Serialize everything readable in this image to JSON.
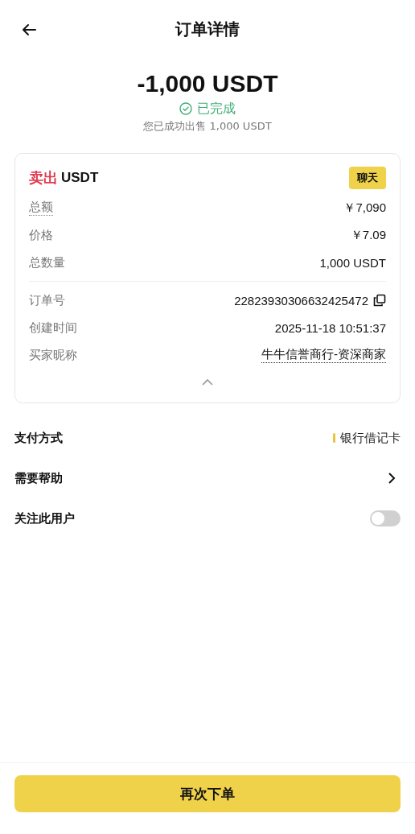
{
  "header": {
    "title": "订单详情"
  },
  "summary": {
    "amount": "-1,000 USDT",
    "status": "已完成",
    "note": "您已成功出售 1,000 USDT"
  },
  "order_card": {
    "side": "卖出",
    "asset": "USDT",
    "chat_button": "聊天",
    "expanded": true,
    "rows": [
      {
        "label": "总额",
        "value": "￥7,090",
        "label_dotted": true,
        "value_dotted": false,
        "copyable": false
      },
      {
        "label": "价格",
        "value": "￥7.09",
        "label_dotted": false,
        "value_dotted": false,
        "copyable": false
      },
      {
        "label": "总数量",
        "value": "1,000 USDT",
        "label_dotted": false,
        "value_dotted": false,
        "copyable": false
      }
    ],
    "details": [
      {
        "label": "订单号",
        "value": "22823930306632425472",
        "label_dotted": false,
        "value_dotted": false,
        "copyable": true
      },
      {
        "label": "创建时间",
        "value": "2025-11-18 10:51:37",
        "label_dotted": false,
        "value_dotted": false,
        "copyable": false
      },
      {
        "label": "买家昵称",
        "value": "牛牛信誉商行-资深商家",
        "label_dotted": false,
        "value_dotted": true,
        "copyable": false
      }
    ]
  },
  "settings": [
    {
      "kind": "value",
      "label": "支付方式",
      "value": "银行借记卡",
      "color": "#e8c53a"
    },
    {
      "kind": "link",
      "label": "需要帮助"
    },
    {
      "kind": "toggle",
      "label": "关注此用户",
      "on": false
    }
  ],
  "action_button": "再次下单"
}
